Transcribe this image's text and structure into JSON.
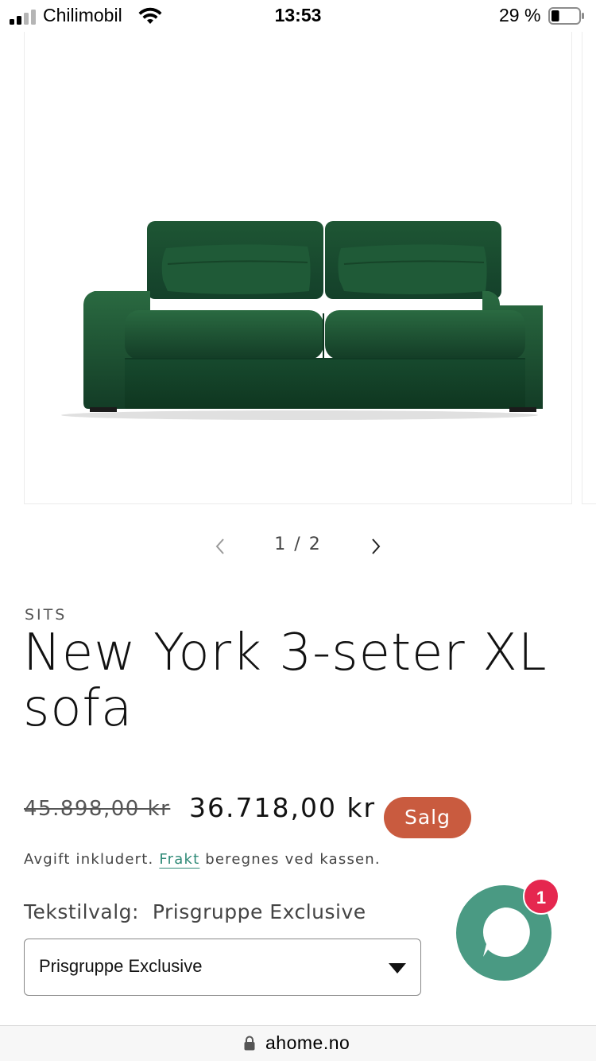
{
  "status_bar": {
    "carrier": "Chilimobil",
    "time": "13:53",
    "battery_percent": "29 %",
    "battery_level": 0.29,
    "signal_bars_active": 2,
    "icons": [
      "signal-icon",
      "wifi-icon",
      "battery-icon"
    ]
  },
  "gallery": {
    "image": "green-velvet-sofa",
    "counter": "1 / 2",
    "prev_icon": "chevron-left-icon",
    "next_icon": "chevron-right-icon"
  },
  "product": {
    "vendor": "SITS",
    "title": "New York 3-seter XL sofa",
    "compare_price": "45.898,00 kr",
    "sale_price": "36.718,00 kr",
    "badge": "Salg",
    "tax_prefix": "Avgift inkludert.",
    "shipping_link": "Frakt",
    "tax_suffix": "beregnes ved kassen.",
    "option_name": "Tekstilvalg:",
    "option_selected": "Prisgruppe Exclusive",
    "select_value": "Prisgruppe Exclusive"
  },
  "chat": {
    "unread_count": "1",
    "icon": "chat-bubble-icon"
  },
  "browser": {
    "domain": "ahome.no",
    "icon": "lock-icon"
  },
  "colors": {
    "sale_badge": "#c95b3f",
    "link": "#2f8a77",
    "chat_button": "#4a9a83",
    "notification_badge": "#e5274f",
    "sofa_velvet": "#1d4a2c"
  }
}
